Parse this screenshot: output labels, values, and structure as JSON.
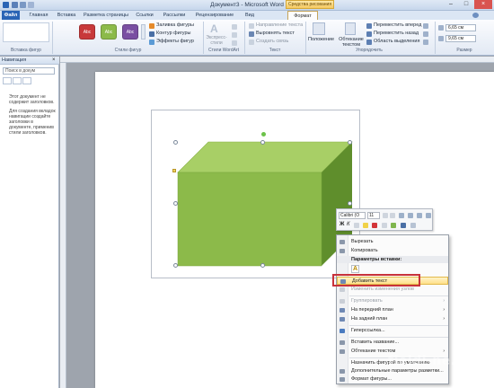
{
  "window": {
    "title": "Документ3 - Microsoft Word",
    "context_tab_group": "Средства рисования"
  },
  "tabs": [
    "Файл",
    "Главная",
    "Вставка",
    "Разметка страницы",
    "Ссылки",
    "Рассылки",
    "Рецензирование",
    "Вид",
    "Формат"
  ],
  "ribbon": {
    "insert_shapes": {
      "label": "Вставка фигур"
    },
    "shape_styles": {
      "label": "Стили фигур",
      "style_sample": "Abc",
      "fill": "Заливка фигуры",
      "outline": "Контур фигуры",
      "effects": "Эффекты фигур"
    },
    "wordart": {
      "label": "Стили WordArt",
      "express": "Экспресс-стили",
      "text_fill_a": "A"
    },
    "text": {
      "label": "Текст",
      "direction": "Направление текста",
      "align": "Выровнять текст",
      "link": "Создать связь"
    },
    "arrange": {
      "label": "Упорядочить",
      "position": "Положение",
      "wrap": "Обтекание текстом",
      "forward": "Переместить вперед",
      "backward": "Переместить назад",
      "selection": "Область выделения"
    },
    "size": {
      "label": "Размер",
      "height": "6,65 см",
      "width": "9,65 см"
    }
  },
  "navpane": {
    "title": "Навигация",
    "search_placeholder": "Поиск в докум",
    "message_1": "Этот документ не содержит заголовков.",
    "message_2": "Для создания вкладок навигации создайте заголовки в документе, применив стили заголовков."
  },
  "minitoolbar": {
    "font": "Calibri (О",
    "size": "11"
  },
  "context_menu": {
    "items": [
      {
        "label": "Вырезать",
        "state": "normal"
      },
      {
        "label": "Копировать",
        "state": "normal"
      },
      {
        "label": "Параметры вставки:",
        "state": "header"
      },
      {
        "label": "Добавить текст",
        "state": "highlighted"
      },
      {
        "label": "Изменить изменения узлов",
        "state": "disabled"
      },
      {
        "label": "Группировать",
        "state": "disabled"
      },
      {
        "label": "На передний план",
        "state": "normal"
      },
      {
        "label": "На задний план",
        "state": "normal"
      },
      {
        "label": "Гиперссылка...",
        "state": "normal"
      },
      {
        "label": "Вставить название...",
        "state": "normal"
      },
      {
        "label": "Обтекание текстом",
        "state": "normal"
      },
      {
        "label": "Назначить фигурой по умолчанию",
        "state": "normal"
      },
      {
        "label": "Дополнительные параметры разметки...",
        "state": "normal"
      },
      {
        "label": "Формат фигуры...",
        "state": "normal"
      }
    ]
  },
  "watermark": "fieldi-ne.com",
  "colors": {
    "cube_front": "#8cba4a",
    "cube_top": "#a8cf66",
    "cube_side": "#5f8e2c",
    "highlight_border": "#c8323a",
    "file_tab": "#2a64b5"
  }
}
